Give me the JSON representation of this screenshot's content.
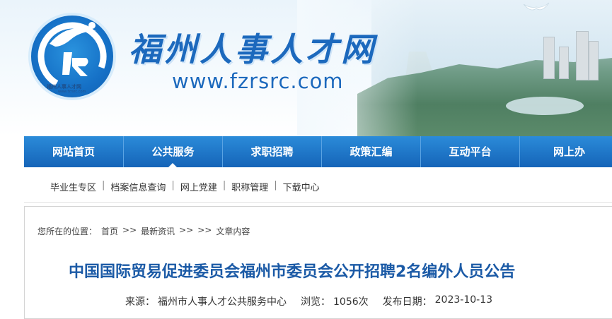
{
  "header": {
    "logo_caption": "福州人事人才网",
    "logo_url": "www.fzrsrc.com",
    "site_title": "福州人事人才网",
    "site_url": "www.fzrsrc.com"
  },
  "nav": {
    "items": [
      {
        "label": "网站首页"
      },
      {
        "label": "公共服务"
      },
      {
        "label": "求职招聘"
      },
      {
        "label": "政策汇编"
      },
      {
        "label": "互动平台"
      },
      {
        "label": "网上办"
      }
    ],
    "active_index": 1
  },
  "subnav": {
    "items": [
      {
        "label": "毕业生专区"
      },
      {
        "label": "档案信息查询"
      },
      {
        "label": "网上党建"
      },
      {
        "label": "职称管理"
      },
      {
        "label": "下载中心"
      }
    ],
    "separator": "|"
  },
  "breadcrumb": {
    "prefix": "您所在的位置：",
    "home": "首页",
    "sep1": ">>",
    "news": "最新资讯",
    "sep2": ">>",
    "sep3": ">>",
    "current": "文章内容"
  },
  "article": {
    "title": "中国国际贸易促进委员会福州市委员会公开招聘2名编外人员公告",
    "source_label": "来源：",
    "source": "福州市人事人才公共服务中心",
    "views_label": "浏览：",
    "views": "1056次",
    "date_label": "发布日期：",
    "date": "2023-10-13"
  },
  "colors": {
    "brand_blue": "#1c69bd",
    "nav_top": "#2b8bd9",
    "nav_bottom": "#1564b8",
    "title_blue": "#1b5aa6"
  }
}
